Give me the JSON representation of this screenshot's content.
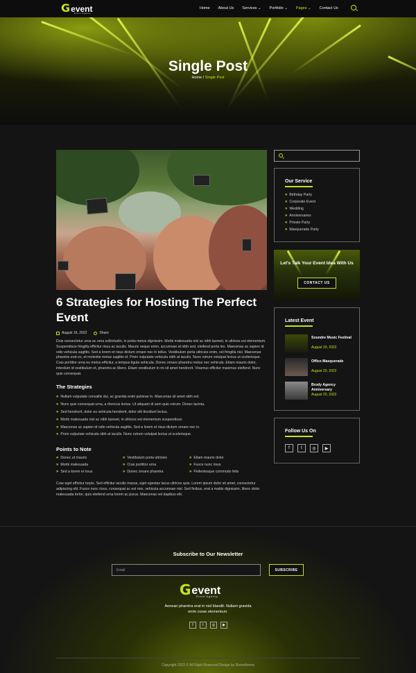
{
  "header": {
    "logo_g": "G",
    "logo_word": "event",
    "logo_sub": "Event Agency",
    "menu": [
      {
        "label": "Home"
      },
      {
        "label": "About Us"
      },
      {
        "label": "Services ⌄"
      },
      {
        "label": "Portfolio ⌄"
      },
      {
        "label": "Pages ⌄"
      },
      {
        "label": "Contact Us"
      }
    ]
  },
  "hero": {
    "title": "Single Post",
    "crumb_home": "Home",
    "crumb_sep": " / ",
    "crumb_current": "Single Post"
  },
  "post": {
    "title": "6 Strategies for Hosting The Perfect Event",
    "date": "August 16, 2022",
    "share": "Share",
    "intro": "Duis consectetur urna ac urna sollicitudin, in porta metus dignissim. Morbi malesuada nisl ac nibh laoreet, in ultrices est elementum. Suspendisse fringilla efficitur risus ac iaculis. Mauris neque enim, accumsan id nibh sed, eleifend porta leo. Maecenas ac sapien id odio vehicula sagittis. Sed a lorem et risus dictum ornare nec in tellus. Vestibulum porta ultricies enim, vel fringilla nisl. Maecenas pharetra erat ex, et molestie metus sagittis id. Proin vulputate vehicula nibh at iaculis. Nunc rutrum volutpat lectus ut scelerisque. Cras porttitor urna eu metus efficitur, a tempus ligula vehicula. Donec ornare pharetra metus nec vehicula. Etiam mauris dolor, interdum id vestibulum et, pharetra ac libero. Etiam vestibulum in mi sit amet hendrerit. Vivamus efficitur maximus eleifend. Nunc quis consequat.",
    "strategies_heading": "The Strategies",
    "strategies": [
      "Nullam vulputate convallis dui, ac gravida enim pulvinar in. Maecenas sit amet nibh est.",
      "Nunc quis consequat urna, a rhoncus lectus. Ut aliquam id sem quis rutrum. Donec lacinia.",
      "Sed hendrerit, dolor eu vehicula hendrerit, dolor elit tincidunt lectus.",
      "Morbi malesuada nisl ac nibh laoreet, in ultrices est elementum suspendisse.",
      "Maecenas ac sapien id odio vehicula sagittis. Sed a lorem et risus dictum ornare nec in.",
      "Proin vulputate vehicula nibh at iaculis. Nunc rutrum volutpat lectus ut scelerisque."
    ],
    "points_heading": "Points to Note",
    "points": [
      "Donec ut mauris",
      "Vestibulum porta ultricies",
      "Etiam mauris dolor",
      "Morbi malesuada",
      "Cras porttitor urna",
      "Fusce nunc risus",
      "Sed a lorem et risus",
      "Donec ornare pharetra",
      "Pellentesque commodo felis"
    ],
    "outro": "Cras eget efficitur turpis. Sed efficitur iaculis massa, eget egestas lacus ultrices quis. Lorem ipsum dolor sit amet, consectetur adipiscing elit. Fusce nunc risus, consequat ac est non, vehicula accumsan nisl. Sed finibus, erat a mattis dignissim, libero dolor malesuada tortor, quis eleifend urna lorem ac purus. Maecenas vel dapibus elit."
  },
  "sidebar": {
    "service_title": "Our Service",
    "services": [
      "Birthday Party",
      "Corporate Event",
      "Wedding",
      "Anniversaries",
      "Private Party",
      "Masquerade Party"
    ],
    "cta_text": "Let's Talk Your Event Idea With Us",
    "cta_button": "CONTACT US",
    "latest_title": "Latest Event",
    "events": [
      {
        "name": "Soundre Music Festival",
        "date": "August 20, 2022"
      },
      {
        "name": "Office Masquerade",
        "date": "August 20, 2022"
      },
      {
        "name": "Brody Agency Anniversary",
        "date": "August 20, 2022"
      }
    ],
    "follow_title": "Follow Us On"
  },
  "footer": {
    "newsletter_title": "Subscribe to Our Newsletter",
    "email_placeholder": "Email",
    "subscribe_button": "SUBSCRIBE",
    "tagline": "Aenean pharetra erat in nisl blandit. Nullam gravida enim curae elementum.",
    "copyright": "Copyright 2022 © All Right Reserved Design by Rometheme"
  },
  "icons": [
    "search-icon",
    "calendar-icon",
    "share-icon",
    "chevron-right-icon",
    "facebook-icon",
    "twitter-icon",
    "instagram-icon",
    "youtube-icon"
  ],
  "colors": {
    "accent": "#c6e31b",
    "background": "#141414"
  }
}
